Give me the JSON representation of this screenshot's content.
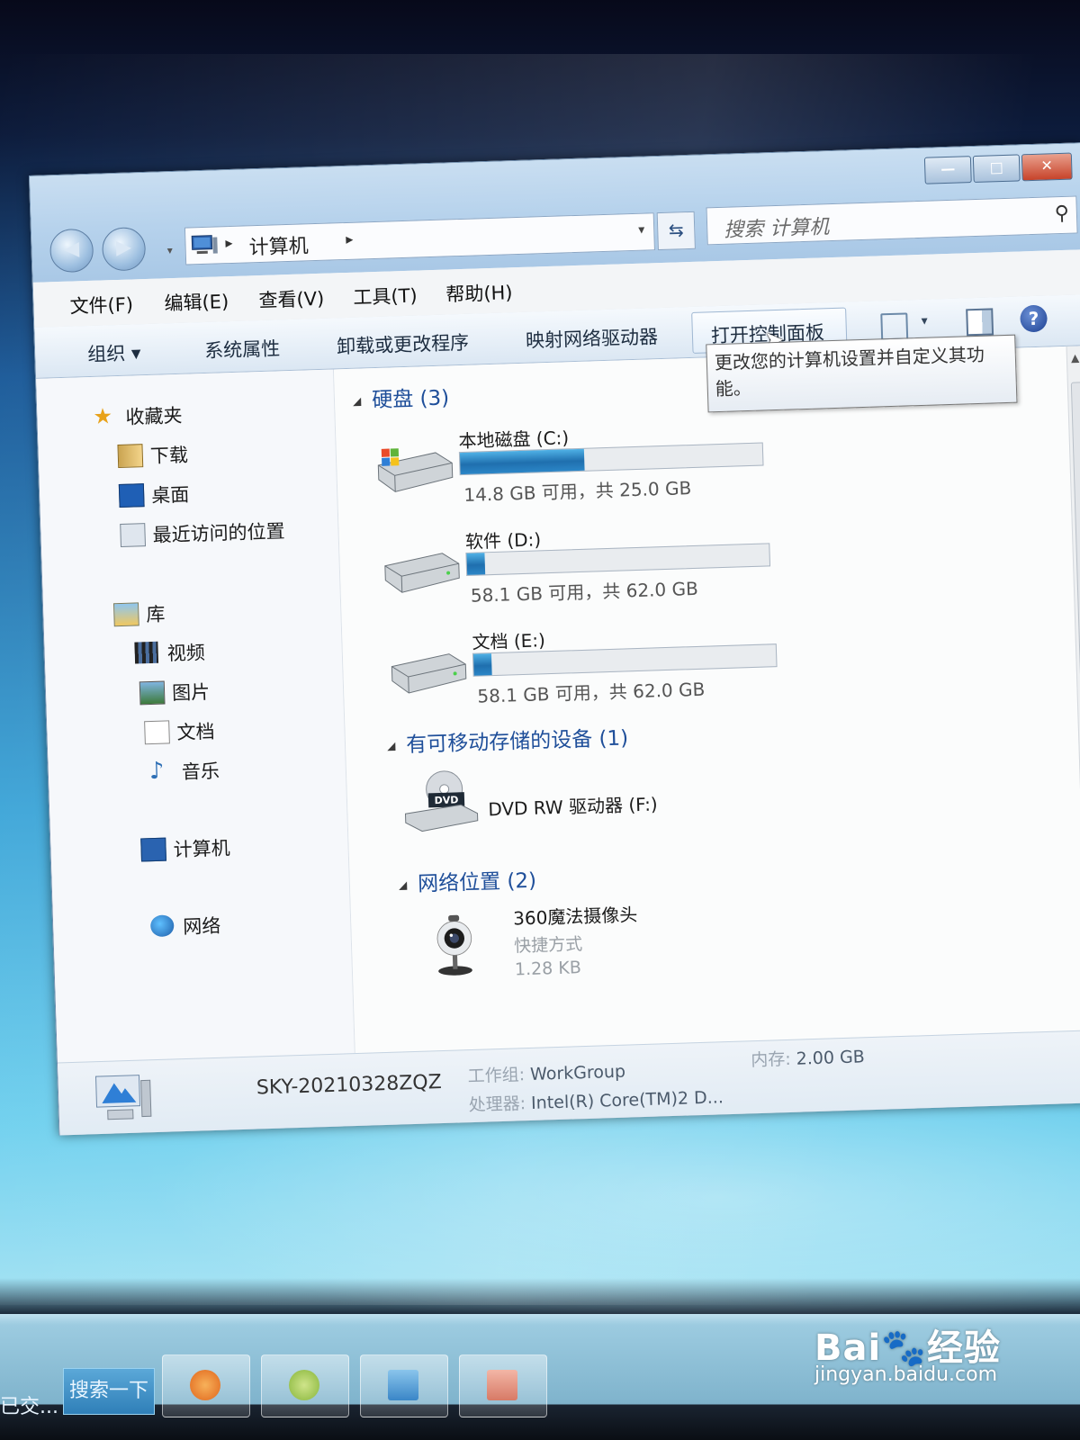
{
  "window": {
    "caption": {
      "minimize": "—",
      "maximize": "□",
      "close": "✕"
    },
    "address": {
      "root_label": "计算机",
      "separator": "▸",
      "dropdown": "▾"
    },
    "search": {
      "placeholder": "搜索 计算机",
      "icon": "search-icon"
    },
    "menu": [
      "文件(F)",
      "编辑(E)",
      "查看(V)",
      "工具(T)",
      "帮助(H)"
    ],
    "toolbar": {
      "organize": "组织 ▾",
      "system_properties": "系统属性",
      "uninstall": "卸载或更改程序",
      "map_drive": "映射网络驱动器",
      "control_panel": "打开控制面板",
      "views_arrow": "▾",
      "help": "?"
    },
    "tooltip": "更改您的计算机设置并自定义其功能。"
  },
  "nav": {
    "favorites": {
      "label": "收藏夹",
      "items": [
        "下载",
        "桌面",
        "最近访问的位置"
      ]
    },
    "libraries": {
      "label": "库",
      "items": [
        "视频",
        "图片",
        "文档",
        "音乐"
      ]
    },
    "computer": "计算机",
    "network": "网络"
  },
  "content": {
    "groups": {
      "hard_disks": "硬盘 (3)",
      "removable": "有可移动存储的设备 (1)",
      "network": "网络位置 (2)"
    },
    "drives": [
      {
        "name": "本地磁盘 (C:)",
        "free_text": "14.8 GB 可用，共 25.0 GB",
        "used_fraction": 0.41
      },
      {
        "name": "软件 (D:)",
        "free_text": "58.1 GB 可用，共 62.0 GB",
        "used_fraction": 0.06
      },
      {
        "name": "文档 (E:)",
        "free_text": "58.1 GB 可用，共 62.0 GB",
        "used_fraction": 0.06
      }
    ],
    "dvd": {
      "name": "DVD RW 驱动器 (F:)",
      "badge": "DVD"
    },
    "camera": {
      "name": "360魔法摄像头",
      "type": "快捷方式",
      "size": "1.28 KB"
    }
  },
  "details": {
    "computer_name": "SKY-20210328ZQZ",
    "workgroup_label": "工作组:",
    "workgroup": "WorkGroup",
    "memory_label": "内存:",
    "memory": "2.00 GB",
    "processor_label": "处理器:",
    "processor": "Intel(R) Core(TM)2 D..."
  },
  "taskbar": {
    "left_text": "已交...",
    "search_button": "搜索一下"
  },
  "watermark": {
    "logo": "Bai🐾经验",
    "url": "jingyan.baidu.com"
  }
}
